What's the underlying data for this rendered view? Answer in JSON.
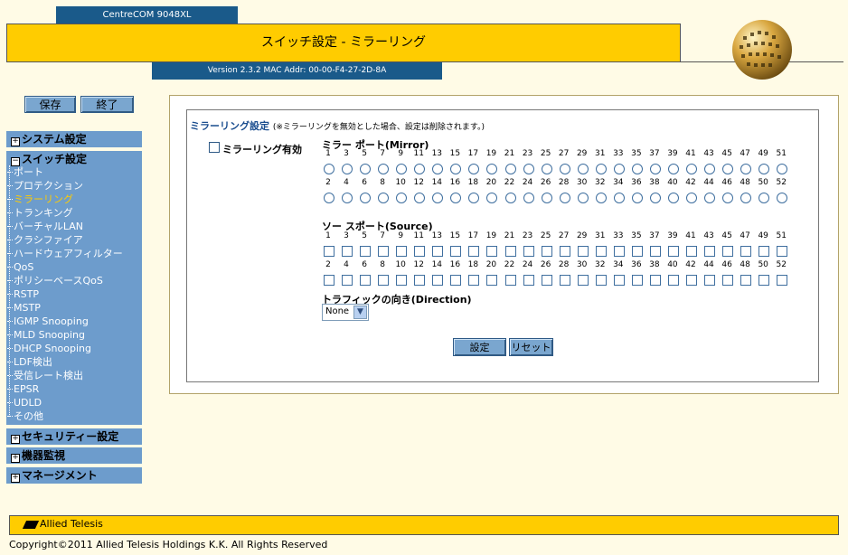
{
  "header": {
    "model": "CentreCOM 9048XL",
    "title": "スイッチ設定 - ミラーリング",
    "version": "Version 2.3.2 MAC Addr: 00-00-F4-27-2D-8A"
  },
  "toolbar": {
    "save_label": "保存",
    "exit_label": "終了"
  },
  "sidebar": {
    "system_settings": "システム設定",
    "switch_settings": "スイッチ設定",
    "items": [
      "ポート",
      "プロテクション",
      "ミラーリング",
      "トランキング",
      "バーチャルLAN",
      "クラシファイア",
      "ハードウェアフィルター",
      "QoS",
      "ポリシーベースQoS",
      "RSTP",
      "MSTP",
      "IGMP Snooping",
      "MLD Snooping",
      "DHCP Snooping",
      "LDF検出",
      "受信レート検出",
      "EPSR",
      "UDLD",
      "その他"
    ],
    "active_index": 2,
    "security_settings": "セキュリティー設定",
    "device_monitoring": "機器監視",
    "management": "マネージメント"
  },
  "main": {
    "section_title": "ミラーリング設定",
    "section_note": "(※ミラーリングを無効とした場合、設定は削除されます。)",
    "enable_label": "ミラーリング有効",
    "mirror_title": "ミラー ポート(Mirror)",
    "source_title": "ソー スポート(Source)",
    "odd_ports": [
      "1",
      "3",
      "5",
      "7",
      "9",
      "11",
      "13",
      "15",
      "17",
      "19",
      "21",
      "23",
      "25",
      "27",
      "29",
      "31",
      "33",
      "35",
      "37",
      "39",
      "41",
      "43",
      "45",
      "47",
      "49",
      "51"
    ],
    "even_ports": [
      "2",
      "4",
      "6",
      "8",
      "10",
      "12",
      "14",
      "16",
      "18",
      "20",
      "22",
      "24",
      "26",
      "28",
      "30",
      "32",
      "34",
      "36",
      "38",
      "40",
      "42",
      "44",
      "46",
      "48",
      "50",
      "52"
    ],
    "direction_label": "トラフィックの向き(Direction)",
    "direction_value": "None",
    "set_label": "設定",
    "reset_label": "リセット"
  },
  "footer": {
    "logo": "Allied Telesis",
    "copyright": "Copyright©2011 Allied Telesis Holdings K.K. All Rights Reserved"
  }
}
